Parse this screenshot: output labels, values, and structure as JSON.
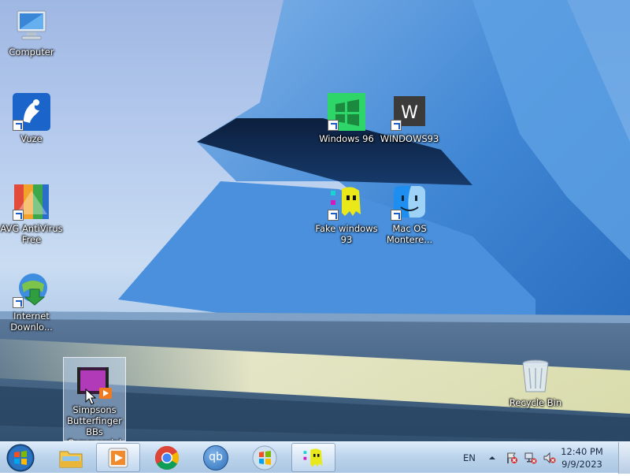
{
  "desktop": {
    "icons": [
      {
        "label": "Computer"
      },
      {
        "label": "Vuze"
      },
      {
        "label": "AVG AntiVirus Free"
      },
      {
        "label": "Internet Downlo..."
      },
      {
        "label": "Simpsons Butterfinger BBs Commercial"
      },
      {
        "label": "Windows 96"
      },
      {
        "label": "WINDOWS93"
      },
      {
        "label": "Fake windows 93"
      },
      {
        "label": "Mac OS Montere..."
      },
      {
        "label": "Recycle Bin"
      }
    ]
  },
  "taskbar": {
    "pinned": [
      {
        "icon": "file-explorer-icon"
      },
      {
        "icon": "media-player-icon"
      },
      {
        "icon": "chrome-icon"
      },
      {
        "icon": "qbittorrent-icon",
        "text": "qb"
      },
      {
        "icon": "windows-flag-icon"
      },
      {
        "icon": "fake-windows-93-icon"
      }
    ],
    "language": "EN",
    "clock": {
      "time": "12:40 PM",
      "date": "9/9/2023"
    }
  },
  "colors": {
    "accent": "#2c73c8",
    "taskbar": "#c0d6ee"
  }
}
